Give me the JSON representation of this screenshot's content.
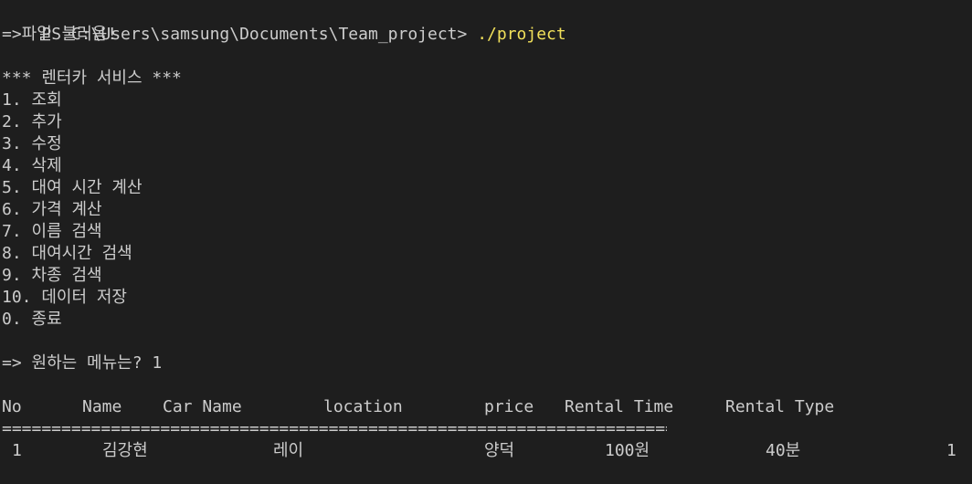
{
  "terminal": {
    "prompt": "PS C:\\Users\\samsung\\Documents\\Team_project> ",
    "command": "./project",
    "colors": {
      "background": "#1e1e1e",
      "text": "#cccccc",
      "command": "#f1e05a"
    }
  },
  "output": {
    "file_loaded": "=>파일 불러옴!",
    "service_title": "*** 렌터카 서비스 ***",
    "menu": [
      "1. 조회",
      "2. 추가",
      "3. 수정",
      "4. 삭제",
      "5. 대여 시간 계산",
      "6. 가격 계산",
      "7. 이름 검색",
      "8. 대여시간 검색",
      "9. 차종 검색",
      "10. 데이터 저장",
      "0. 종료"
    ],
    "menu_prompt": "=> 원하는 메뉴는? 1"
  },
  "table": {
    "headers": [
      "No",
      "Name",
      "Car Name",
      "location",
      "price",
      "Rental Time",
      "Rental Type"
    ],
    "divider": "====================================================================",
    "rows": [
      [
        "1",
        "김강현",
        "레이",
        "양덕",
        "100원",
        "40분",
        "1"
      ]
    ]
  }
}
